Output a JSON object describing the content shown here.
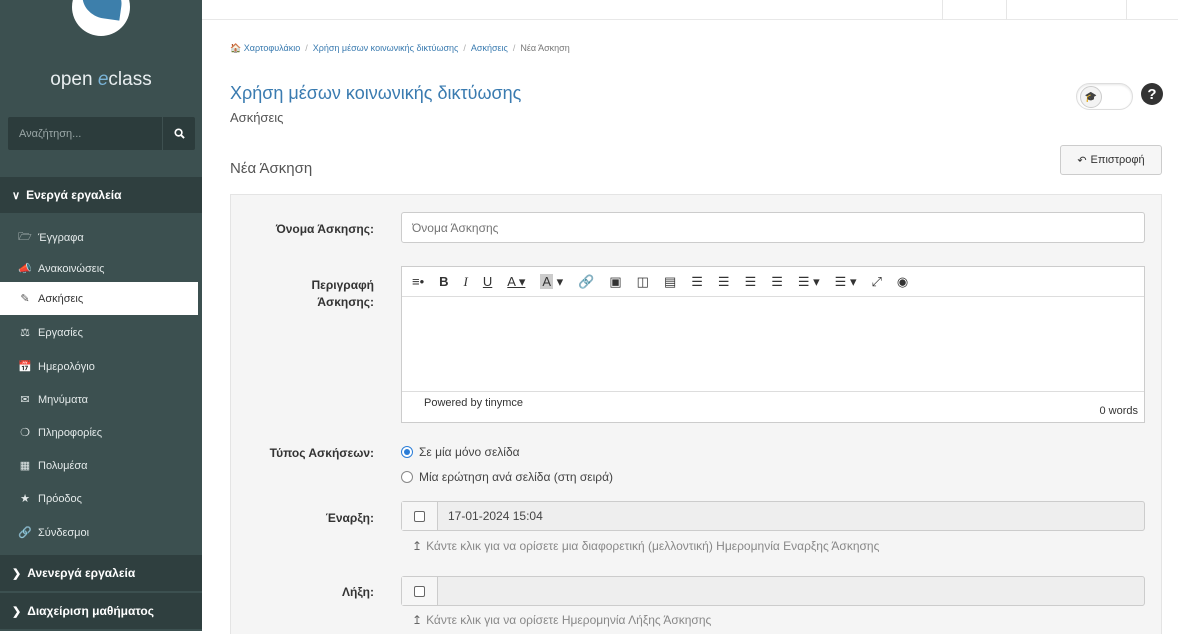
{
  "sidebar": {
    "brand": {
      "prefix": "open ",
      "accent": "e",
      "suffix": "class"
    },
    "search_placeholder": "Αναζήτηση...",
    "active_tools_label": "Ενεργά εργαλεία",
    "items": [
      {
        "label": "Έγγραφα",
        "icon": "folder-open-icon"
      },
      {
        "label": "Ανακοινώσεις",
        "icon": "bullhorn-icon"
      },
      {
        "label": "Ασκήσεις",
        "icon": "pencil-square-icon"
      },
      {
        "label": "Εργασίες",
        "icon": "flask-icon"
      },
      {
        "label": "Ημερολόγιο",
        "icon": "calendar-icon"
      },
      {
        "label": "Μηνύματα",
        "icon": "envelope-icon"
      },
      {
        "label": "Πληροφορίες",
        "icon": "info-circle-icon"
      },
      {
        "label": "Πολυμέσα",
        "icon": "film-icon"
      },
      {
        "label": "Πρόοδος",
        "icon": "trophy-icon"
      },
      {
        "label": "Σύνδεσμοι",
        "icon": "link-icon"
      }
    ],
    "inactive_tools_label": "Ανενεργά εργαλεία",
    "course_admin_label": "Διαχείριση μαθήματος"
  },
  "breadcrumb": {
    "home": "Χαρτοφυλάκιο",
    "course": "Χρήση μέσων κοινωνικής δικτύωσης",
    "section": "Ασκήσεις",
    "current": "Νέα Άσκηση"
  },
  "header": {
    "course_title": "Χρήση μέσων κοινωνικής δικτύωσης",
    "subtitle": "Ασκήσεις",
    "help_glyph": "?"
  },
  "page": {
    "title": "Νέα Άσκηση",
    "back_label": "Επιστροφή"
  },
  "form": {
    "name_label": "Όνομα Άσκησης:",
    "name_placeholder": "Όνομα Άσκησης",
    "description_label_line1": "Περιγραφή",
    "description_label_line2": "Άσκησης:",
    "editor_powered": "Powered by tinymce",
    "editor_wordcount": "0 words",
    "type_label": "Τύπος Ασκήσεων:",
    "type_options": [
      "Σε μία μόνο σελίδα",
      "Μία ερώτηση ανά σελίδα (στη σειρά)"
    ],
    "type_selected": 0,
    "start_label": "Έναρξη:",
    "start_value": "17-01-2024 15:04",
    "start_hint": "Κάντε κλικ για να ορίσετε μια διαφορετική (μελλοντική) Ημερομηνία Εναρξης Άσκησης",
    "end_label": "Λήξη:",
    "end_value": "",
    "end_hint": "Κάντε κλικ για να ορίσετε Ημερομηνία Λήξης Άσκησης"
  },
  "colors": {
    "sidebar_bg": "#3c5050",
    "link": "#3a7bb0",
    "radio": "#2b7dd7"
  }
}
